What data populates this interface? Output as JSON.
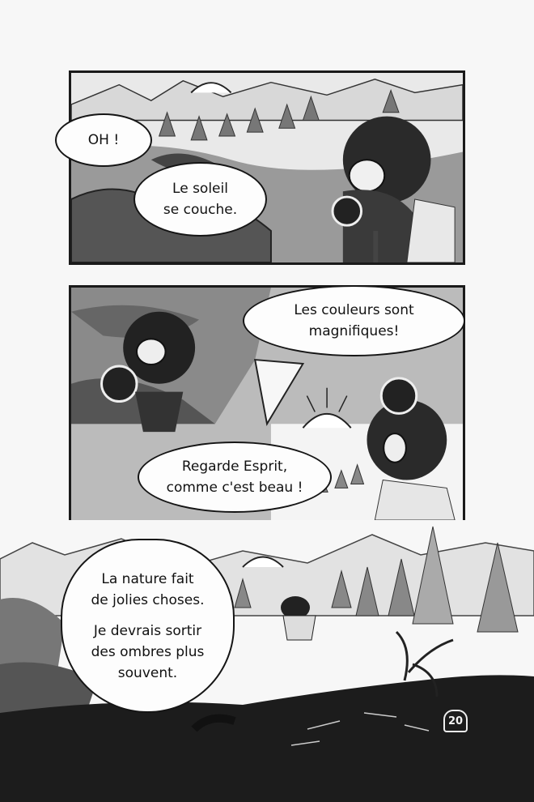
{
  "panels": [
    {
      "bubbles": [
        {
          "lines": [
            "OH !"
          ]
        },
        {
          "lines": [
            "Le soleil",
            "se couche."
          ]
        }
      ]
    },
    {
      "bubbles": [
        {
          "lines": [
            "Les couleurs sont",
            "magnifiques!"
          ]
        },
        {
          "lines": [
            "Regarde Esprit,",
            "comme c'est beau !"
          ]
        }
      ]
    },
    {
      "bubbles": [
        {
          "lines": [
            "La nature fait",
            "de jolies choses.",
            "",
            "Je devrais sortir",
            "des ombres plus",
            "souvent."
          ]
        }
      ]
    }
  ],
  "page_number": "20",
  "colors": {
    "ink": "#151515",
    "paper": "#f7f7f7"
  }
}
